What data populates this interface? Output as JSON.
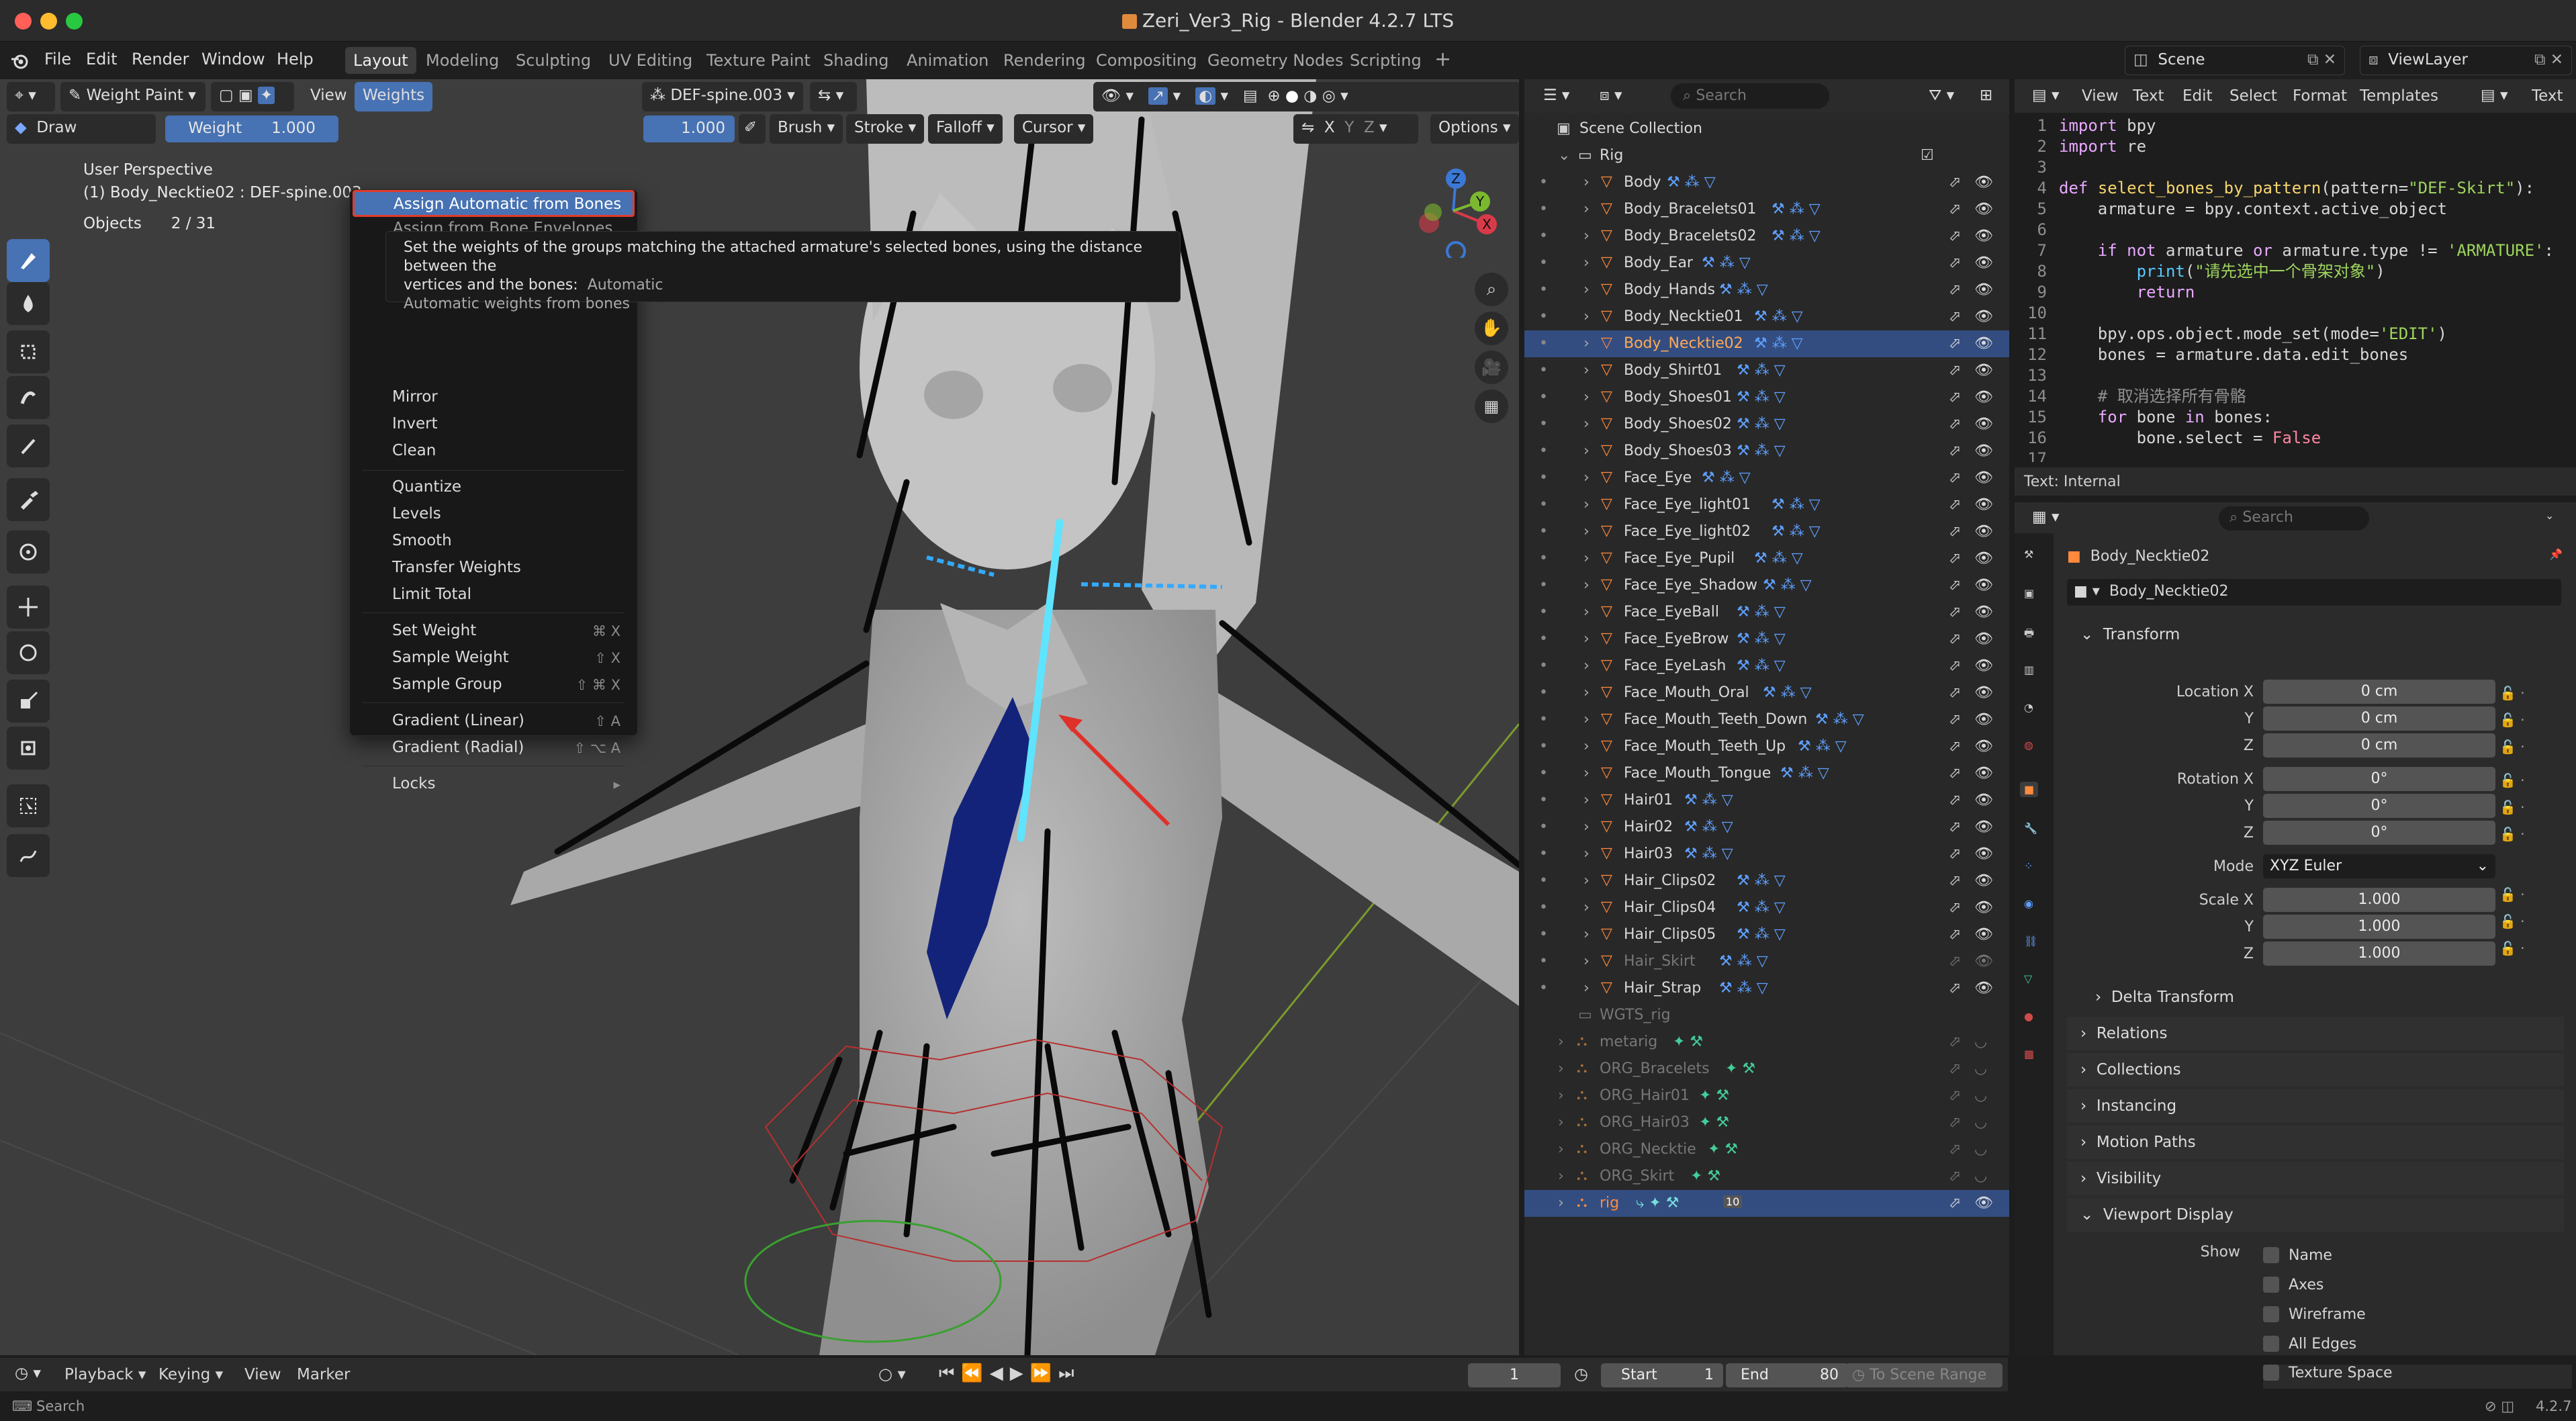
{
  "window": {
    "title": "Zeri_Ver3_Rig - Blender 4.2.7 LTS",
    "traffic": [
      "#ff5f57",
      "#febc2e",
      "#28c840"
    ]
  },
  "menubar": {
    "items": [
      "File",
      "Edit",
      "Render",
      "Window",
      "Help"
    ],
    "workspaces": [
      "Layout",
      "Modeling",
      "Sculpting",
      "UV Editing",
      "Texture Paint",
      "Shading",
      "Animation",
      "Rendering",
      "Compositing",
      "Geometry Nodes",
      "Scripting"
    ],
    "active_workspace": "Layout",
    "scene": "Scene",
    "view_layer": "ViewLayer"
  },
  "viewport": {
    "mode": "Weight Paint",
    "view_menu": "View",
    "weights_menu": "Weights",
    "vertex_group": "DEF-spine.003",
    "brush": "Draw",
    "weight_label": "Weight",
    "weight_value": "1.000",
    "strength_value": "1.000",
    "brush_menu": "Brush",
    "stroke_menu": "Stroke",
    "falloff_menu": "Falloff",
    "cursor_menu": "Cursor",
    "options_menu": "Options",
    "axis_x": "X",
    "axis_y": "Y",
    "axis_z": "Z",
    "overlay_title": "User Perspective",
    "overlay_object": "(1) Body_Necktie02 : DEF-spine.003",
    "objects_label": "Objects",
    "objects_count": "2 / 31",
    "gizmo": {
      "x": "X",
      "y": "Y",
      "z": "Z"
    }
  },
  "weights_menu": {
    "highlighted": "Assign Automatic from Bones",
    "partial": "Assign from Bone Envelopes",
    "items": [
      {
        "label": "Mirror",
        "shortcut": ""
      },
      {
        "label": "Invert",
        "shortcut": ""
      },
      {
        "label": "Clean",
        "shortcut": ""
      },
      {
        "label": "Quantize",
        "shortcut": ""
      },
      {
        "label": "Levels",
        "shortcut": ""
      },
      {
        "label": "Smooth",
        "shortcut": ""
      },
      {
        "label": "Transfer Weights",
        "shortcut": ""
      },
      {
        "label": "Limit Total",
        "shortcut": ""
      },
      {
        "label": "Set Weight",
        "shortcut": "⌘ X"
      },
      {
        "label": "Sample Weight",
        "shortcut": "⇧ X"
      },
      {
        "label": "Sample Group",
        "shortcut": "⇧ ⌘ X"
      },
      {
        "label": "Gradient (Linear)",
        "shortcut": "⇧ A"
      },
      {
        "label": "Gradient (Radial)",
        "shortcut": "⇧ ⌥ A"
      },
      {
        "label": "Locks",
        "shortcut": "▸"
      }
    ]
  },
  "tooltip": {
    "line1": "Set the weights of the groups matching the attached armature's selected bones, using the distance between the",
    "line2_prefix": "vertices and the bones:",
    "line2_value": "Automatic",
    "line3": "Automatic weights from bones"
  },
  "outliner": {
    "search_placeholder": "Search",
    "root": "Scene Collection",
    "collection": "Rig",
    "objects": [
      "Body",
      "Body_Bracelets01",
      "Body_Bracelets02",
      "Body_Ear",
      "Body_Hands",
      "Body_Necktie01",
      "Body_Necktie02",
      "Body_Shirt01",
      "Body_Shoes01",
      "Body_Shoes02",
      "Body_Shoes03",
      "Face_Eye",
      "Face_Eye_light01",
      "Face_Eye_light02",
      "Face_Eye_Pupil",
      "Face_Eye_Shadow",
      "Face_EyeBall",
      "Face_EyeBrow",
      "Face_EyeLash",
      "Face_Mouth_Oral",
      "Face_Mouth_Teeth_Down",
      "Face_Mouth_Teeth_Up",
      "Face_Mouth_Tongue",
      "Hair01",
      "Hair02",
      "Hair03",
      "Hair_Clips02",
      "Hair_Clips04",
      "Hair_Clips05",
      "Hair_Skirt",
      "Hair_Strap"
    ],
    "selected": "Body_Necktie02",
    "hidden": "Hair_Skirt",
    "collection2": "WGTS_rig",
    "armatures": [
      "metarig",
      "ORG_Bracelets",
      "ORG_Hair01",
      "ORG_Hair03",
      "ORG_Necktie",
      "ORG_Skirt"
    ],
    "rig": "rig",
    "rig_badge": "10"
  },
  "texteditor": {
    "menus": [
      "View",
      "Text",
      "Edit",
      "Select",
      "Format",
      "Templates"
    ],
    "text_name": "Text",
    "footer": "Text: Internal"
  },
  "properties": {
    "search_placeholder": "Search",
    "object_name": "Body_Necktie02",
    "data_name": "Body_Necktie02",
    "transform_label": "Transform",
    "location": {
      "label_x": "Location X",
      "label_y": "Y",
      "label_z": "Z",
      "x": "0 cm",
      "y": "0 cm",
      "z": "0 cm"
    },
    "rotation": {
      "label_x": "Rotation X",
      "label_y": "Y",
      "label_z": "Z",
      "x": "0°",
      "y": "0°",
      "z": "0°"
    },
    "mode_label": "Mode",
    "mode_value": "XYZ Euler",
    "scale": {
      "label_x": "Scale X",
      "label_y": "Y",
      "label_z": "Z",
      "x": "1.000",
      "y": "1.000",
      "z": "1.000"
    },
    "delta": "Delta Transform",
    "sections": [
      "Relations",
      "Collections",
      "Instancing",
      "Motion Paths",
      "Visibility"
    ],
    "viewport_display": "Viewport Display",
    "show_label": "Show",
    "show_items": [
      "Name",
      "Axes",
      "Wireframe",
      "All Edges",
      "Texture Space"
    ]
  },
  "timeline": {
    "playback": "Playback",
    "keying": "Keying",
    "view": "View",
    "marker": "Marker",
    "current_frame": "1",
    "start_label": "Start",
    "start": "1",
    "end_label": "End",
    "end": "80",
    "range_label": "To Scene Range"
  },
  "statusbar": {
    "left": "Search",
    "version": "4.2.7"
  }
}
